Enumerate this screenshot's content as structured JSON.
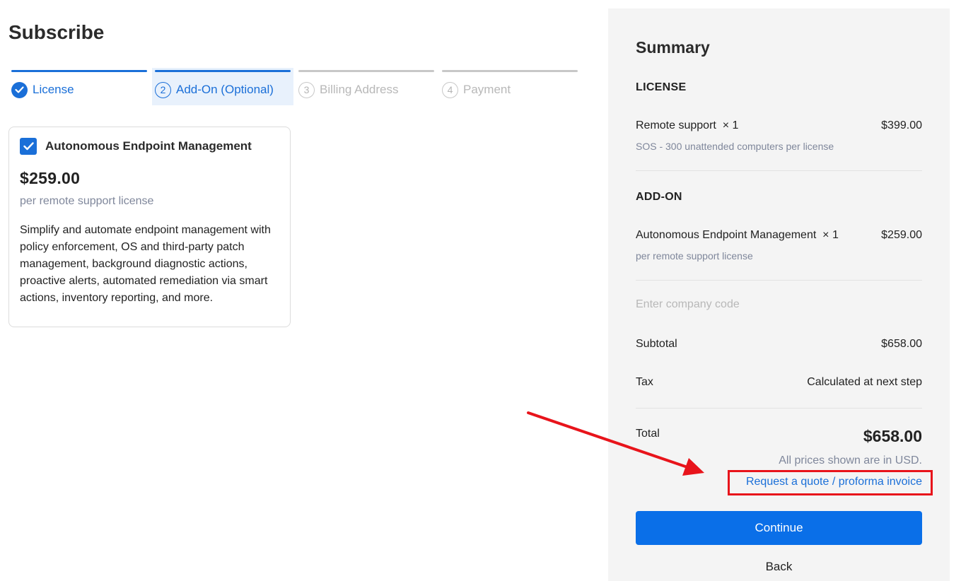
{
  "page": {
    "title": "Subscribe"
  },
  "stepper": {
    "steps": [
      {
        "number": "",
        "label": "License",
        "state": "done"
      },
      {
        "number": "2",
        "label": "Add-On (Optional)",
        "state": "active"
      },
      {
        "number": "3",
        "label": "Billing Address",
        "state": "pending"
      },
      {
        "number": "4",
        "label": "Payment",
        "state": "pending"
      }
    ]
  },
  "addon_card": {
    "title": "Autonomous Endpoint Management",
    "checked": true,
    "price": "$259.00",
    "unit": "per remote support license",
    "description": "Simplify and automate endpoint management with policy enforcement, OS and third-party patch management, background diagnostic actions, proactive alerts, automated remediation via smart actions, inventory reporting, and more."
  },
  "summary": {
    "title": "Summary",
    "license_section": "LICENSE",
    "license_item": {
      "name": "Remote support",
      "qty": "× 1",
      "price": "$399.00",
      "detail": "SOS - 300 unattended computers per license"
    },
    "addon_section": "ADD-ON",
    "addon_item": {
      "name": "Autonomous Endpoint Management",
      "qty": "× 1",
      "price": "$259.00",
      "detail": "per remote support license"
    },
    "company_code_placeholder": "Enter company code",
    "subtotal_label": "Subtotal",
    "subtotal_value": "$658.00",
    "tax_label": "Tax",
    "tax_value": "Calculated at next step",
    "total_label": "Total",
    "total_value": "$658.00",
    "currency_note": "All prices shown are in USD.",
    "quote_link": "Request a quote / proforma invoice",
    "continue_label": "Continue",
    "back_label": "Back"
  },
  "colors": {
    "accent": "#1a6fd8",
    "button": "#0a6fe8",
    "annotation": "#e8141b"
  }
}
